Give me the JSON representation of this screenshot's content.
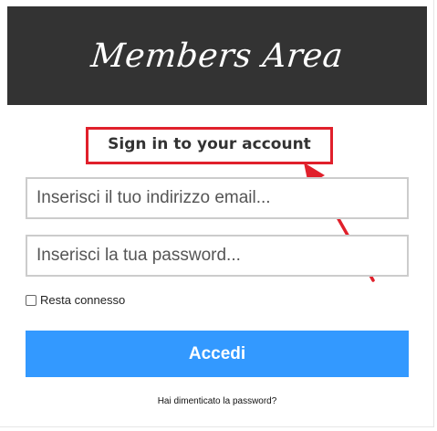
{
  "header": {
    "title": "Members Area"
  },
  "form": {
    "subtitle": "Sign in to your account",
    "email_placeholder": "Inserisci il tuo indirizzo email...",
    "password_placeholder": "Inserisci la tua password...",
    "remember_label": "Resta connesso",
    "remember_checked": false,
    "submit_label": "Accedi",
    "forgot_link": "Hai dimenticato la password?"
  },
  "annotation": {
    "highlight_color": "#e0202b",
    "arrow_icon": "arrow-up-left-icon"
  },
  "colors": {
    "header_bg": "#333333",
    "button_bg": "#3399ff"
  }
}
